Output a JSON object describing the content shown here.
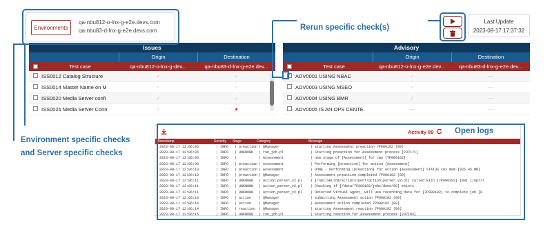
{
  "environment": {
    "button_label": "Environments",
    "hosts": [
      "qa-nbu812-o-lnx-g-e2e.devs.com",
      "qa-nbu83-d-lnx-g-e2e.devs.com"
    ]
  },
  "last_update": {
    "label": "Last Update",
    "value": "2023-08-17 17:37:32"
  },
  "annotations": {
    "rerun": "Rerun specific check(s)",
    "open_logs": "Open logs",
    "env_line1": "Environment specific checks",
    "env_line2": "and Server specific checks"
  },
  "issues": {
    "title": "Issues",
    "origin": "Origin",
    "destination": "Destination",
    "test_case": "Test case",
    "origin_host": "qa-nbu812-o-lnx-g-dev...",
    "dest_host": "qa-nbu83-d-lnx-g-e2e.dev...",
    "rows": [
      {
        "name": "ISS0012 Catalog Structure",
        "o": "✓",
        "d": "✓",
        "d_warn": false
      },
      {
        "name": "ISS0014 Master Name on M",
        "o": "✓",
        "d": "✓",
        "d_warn": false
      },
      {
        "name": "ISS0020 Media Server confi",
        "o": "✓",
        "d": "✓",
        "d_warn": false
      },
      {
        "name": "ISS0026 Media Server Conn",
        "o": "✓",
        "d": "▲",
        "d_warn": true
      }
    ]
  },
  "advisory": {
    "title": "Advisory",
    "origin": "Origin",
    "destination": "Destination",
    "test_case": "Test case",
    "origin_host": "qa-nbu812-o-lnx-g-e2e.dev...",
    "dest_host": "qa-nbu83-d-lnx-g-e2e.dev...",
    "rows": [
      {
        "name": "ADV0001 USING NBAC",
        "o": "✓",
        "d": "—",
        "checked": true
      },
      {
        "name": "ADV0003 USING MSEO",
        "o": "✓",
        "d": "—",
        "checked": false
      },
      {
        "name": "ADV0004 USING BMR",
        "o": "✓",
        "d": "—",
        "checked": false
      },
      {
        "name": "ADV0005 IS AN OPS CENTE",
        "o": "—",
        "d": "—",
        "checked": false
      }
    ]
  },
  "log": {
    "activity": "Activity 89",
    "columns": [
      "Timestamp",
      "Severity",
      "Stage",
      "Category",
      "Message"
    ],
    "lines": [
      [
        "2023-08-17 12:06:05",
        "| INFO",
        "| preaction",
        "| QManager",
        "| starting Assessment preaction 7P000102 (89)"
      ],
      [
        "2023-08-17 12:06:06",
        "| INFO",
        "| UNKNOWN",
        "| run_job.pl",
        "| Starting preaction for Assessment process [237171]"
      ],
      [
        "2023-08-17 12:06:06",
        "| INFO",
        "|",
        "| Assessment",
        "| new stage of [Assessment] for cmp [7P000102]"
      ],
      [
        "2023-08-17 12:06:06",
        "| INFO",
        "| preaction",
        "| Assessment",
        "| Performing [preaction] for action [Assessment]"
      ],
      [
        "2023-08-17 12:06:10",
        "| INFO",
        "| preaction",
        "| Assessment",
        "| DONE - Performing [preaction] for action [Assessment] STATUS <0> mem [926.45 MB]"
      ],
      [
        "2023-08-17 12:06:10",
        "| INFO",
        "| preaction",
        "| QManager",
        "| Assessment preaction completed 7P000102 (89)"
      ],
      [
        "2023-08-17 12:06:11",
        "| INFO",
        "| UNKNOWN",
        "| action_parser_v2.pl",
        "| [/opt/SRLtom/scripts/perl/action_parser_v2.pl] called with [7P000102] [89] [/opt/t"
      ],
      [
        "2023-08-17 12:06:11",
        "| INFO",
        "| UNKNOWN",
        "| action_parser_v2.pl",
        "| Checking if [/data/7P000102/jobs/done/89] exists"
      ],
      [
        "2023-08-17 12:06:11",
        "| INFO",
        "| UNKNOWN",
        "| action_parser_v2.pl",
        "| Detected Virtual Agent, will use recording data for [7P000102] to complete job [8"
      ],
      [
        "2023-08-17 12:06:13",
        "| INFO",
        "| action",
        "| QManager",
        "| submitting Assessment action 7P000102 (89)"
      ],
      [
        "2023-08-17 12:06:14",
        "| INFO",
        "| action",
        "| QManager",
        "| Assessment action completed 7P000102 (89)"
      ],
      [
        "2023-08-17 12:06:14",
        "| INFO",
        "| reaction",
        "| QManager",
        "| starting Assessment reaction 7P000102 (89)"
      ],
      [
        "2023-08-17 12:06:15",
        "| INFO",
        "| UNKNOWN",
        "| run_job.pl",
        "| Starting reaction for Assessment process [237183]"
      ]
    ]
  },
  "colors": {
    "annotation": "#2e6ea6",
    "accent": "#9b2a2a",
    "navy": "#0f3a5e"
  }
}
